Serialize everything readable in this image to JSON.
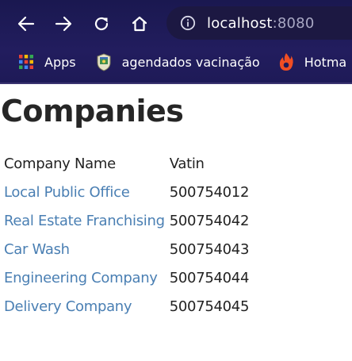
{
  "browser": {
    "url_host": "localhost",
    "url_port": ":8080",
    "bookmarks": [
      {
        "label": "Apps",
        "icon": "apps-grid-icon"
      },
      {
        "label": "agendados vacinação",
        "icon": "crest-icon"
      },
      {
        "label": "Hotma",
        "icon": "flame-icon"
      }
    ],
    "icons": [
      "back-arrow-icon",
      "forward-arrow-icon",
      "reload-icon",
      "home-icon",
      "info-icon"
    ]
  },
  "colors": {
    "chrome_bg": "#1e1a57",
    "link": "#4a7fb3",
    "text": "#222222"
  },
  "page": {
    "title": "Companies",
    "table": {
      "headers": [
        "Company Name",
        "Vatin"
      ],
      "rows": [
        {
          "name": "Local Public Office",
          "vatin": "500754012"
        },
        {
          "name": "Real Estate Franchising",
          "vatin": "500754042"
        },
        {
          "name": "Car Wash",
          "vatin": "500754043"
        },
        {
          "name": "Engineering Company",
          "vatin": "500754044"
        },
        {
          "name": "Delivery Company",
          "vatin": "500754045"
        }
      ]
    }
  }
}
